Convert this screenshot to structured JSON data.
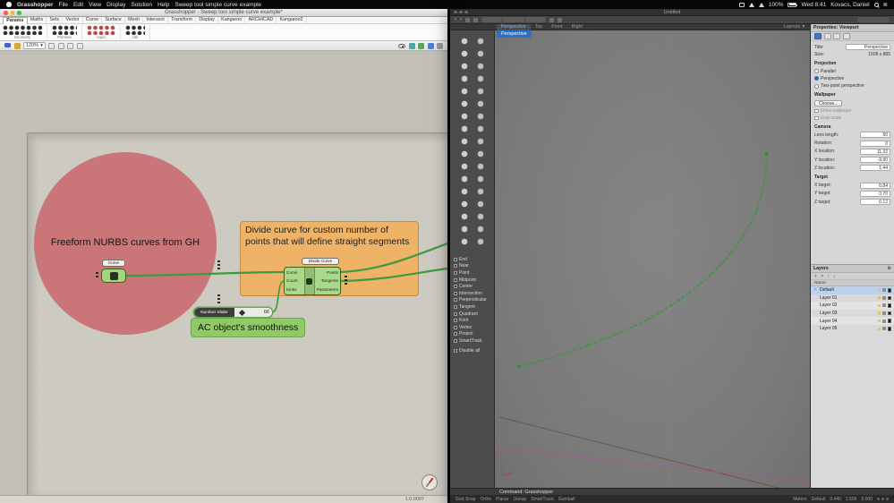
{
  "icons": {
    "caret_down": "▾",
    "check": "✓",
    "gear": "⚙",
    "menu": "≣",
    "back": "‹",
    "forward": "›",
    "plus": "+",
    "close": "×",
    "up": "↑",
    "down": "↓"
  },
  "menubar": {
    "app": "Grasshopper",
    "items": [
      "File",
      "Edit",
      "View",
      "Display",
      "Solution",
      "Help"
    ],
    "doc": "Sweep tool simple curve example",
    "battery": "100%",
    "clock": "Wed 8:41",
    "user": "Kovacs, Daniel"
  },
  "gh": {
    "window_title": "Grasshopper - Sweep tool simple curve example*",
    "tabs": [
      "Params",
      "Maths",
      "Sets",
      "Vector",
      "Curve",
      "Surface",
      "Mesh",
      "Intersect",
      "Transform",
      "Display",
      "Kangaroo",
      "ARCHICAD",
      "Kangaroo2"
    ],
    "palette_groups": [
      "Geometry",
      "Primitive",
      "Input",
      "Util"
    ],
    "zoom": "120%",
    "canvas": {
      "group_note_red": "Freeform NURBS curves from GH",
      "curve_param_label": "Curve",
      "orange_note": "Divide curve for custom number of points that will define straight segments",
      "divide_component": {
        "label": "Divide Curve",
        "inputs": [
          "Curve",
          "Count",
          "Kinks"
        ],
        "outputs": [
          "Points",
          "Tangents",
          "Parameters"
        ]
      },
      "slider_label": "Number Slider",
      "slider_value": "66",
      "green_note": "AC object's smoothness",
      "version": "1.0.0007"
    }
  },
  "rhino": {
    "window_title": "Untitled",
    "view_tabs": [
      "Perspective",
      "Top",
      "Front",
      "Right"
    ],
    "layouts_button": "Layouts",
    "viewport_title": "Perspective",
    "osnap_items": [
      "End",
      "Near",
      "Point",
      "Midpoint",
      "Center",
      "Intersection",
      "Perpendicular",
      "Tangent",
      "Quadrant",
      "Knot",
      "Vertex",
      "Project",
      "SmartTrack",
      "Disable all"
    ],
    "properties": {
      "header": "Properties: Viewport",
      "title_label": "Title:",
      "title_value": "Perspective",
      "size_label": "Size:",
      "size_value": "1508 x 885",
      "projection_label": "Projection",
      "projection_options": [
        "Parallel",
        "Perspective",
        "Two-point perspective"
      ],
      "wallpaper_label": "Wallpaper",
      "wallpaper_choose": "Choose...",
      "wallpaper_options": [
        "Show wallpaper",
        "Gray scale"
      ],
      "camera_label": "Camera",
      "camera_fields": [
        {
          "label": "Lens length:",
          "value": "50"
        },
        {
          "label": "Rotation:",
          "value": "0"
        },
        {
          "label": "X location:",
          "value": "11.32"
        },
        {
          "label": "Y location:",
          "value": "-9.90"
        },
        {
          "label": "Z location:",
          "value": "1.44"
        }
      ],
      "target_label": "Target",
      "target_fields": [
        {
          "label": "X target:",
          "value": "0.84"
        },
        {
          "label": "Y target:",
          "value": "0.70"
        },
        {
          "label": "Z target:",
          "value": "0.12"
        }
      ]
    },
    "layers": {
      "header": "Layers",
      "name_column": "Name",
      "rows": [
        "Default",
        "Layer 01",
        "Layer 02",
        "Layer 03",
        "Layer 04",
        "Layer 05"
      ]
    },
    "command_line": "Command: Grasshopper",
    "status": {
      "toggles": [
        "Grid Snap",
        "Ortho",
        "Planar",
        "Osnap",
        "SmartTrack",
        "Gumball"
      ],
      "units": "Meters",
      "layer": "Default",
      "coords": [
        "0.440",
        "2.506",
        "0.000"
      ]
    }
  }
}
